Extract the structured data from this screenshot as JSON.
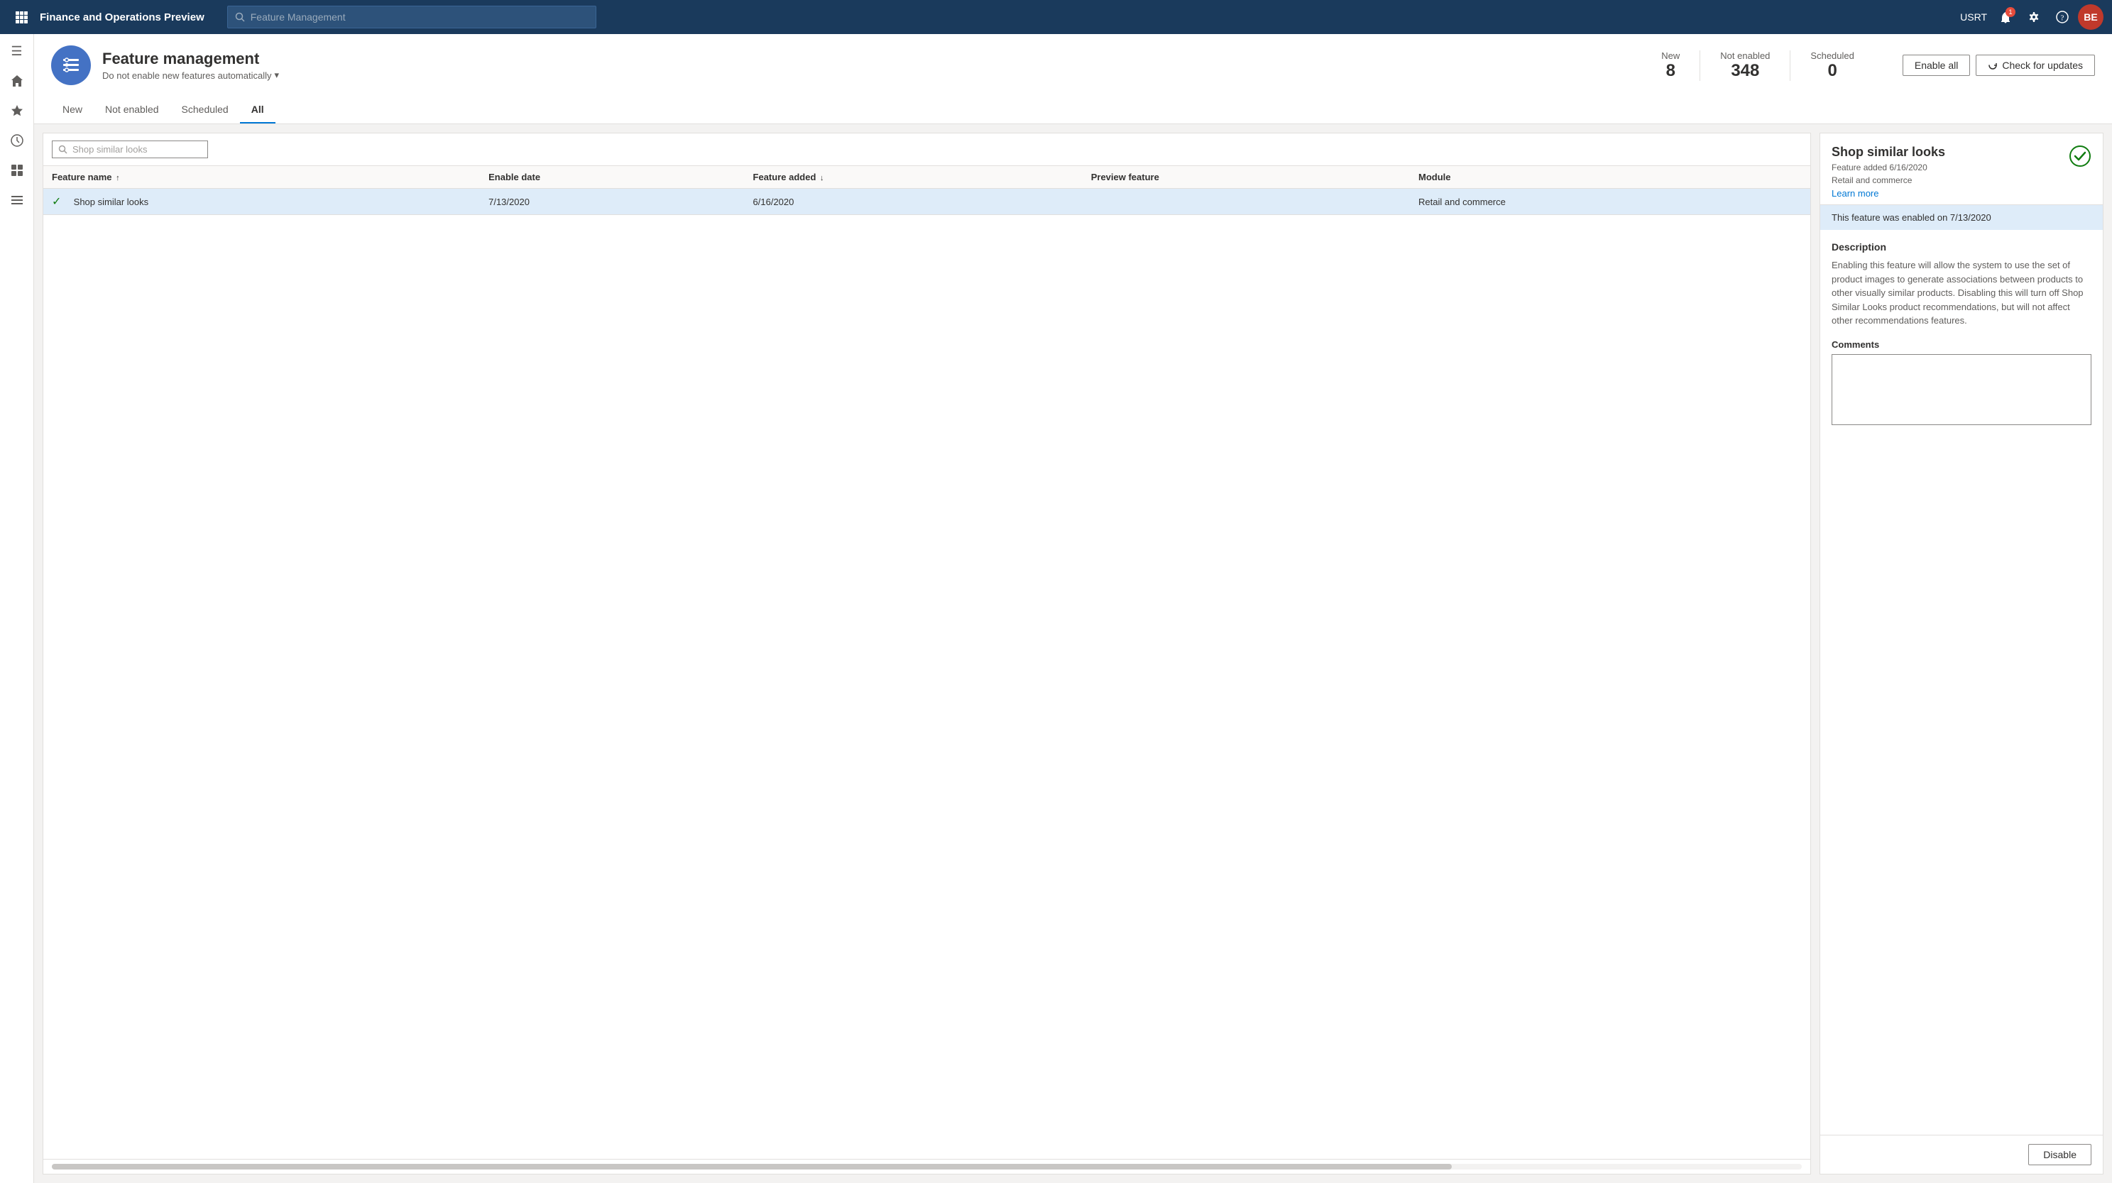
{
  "app": {
    "title": "Finance and Operations Preview"
  },
  "search_placeholder": "Feature Management",
  "topnav": {
    "username": "USRT",
    "avatar_initials": "BE",
    "notification_count": "1"
  },
  "page_header": {
    "title": "Feature management",
    "subtitle": "Do not enable new features automatically",
    "icon_symbol": "≡"
  },
  "stats": [
    {
      "label": "New",
      "value": "8"
    },
    {
      "label": "Not enabled",
      "value": "348"
    },
    {
      "label": "Scheduled",
      "value": "0"
    }
  ],
  "buttons": {
    "enable_all": "Enable all",
    "check_updates": "Check for updates"
  },
  "tabs": [
    {
      "label": "New",
      "active": false
    },
    {
      "label": "Not enabled",
      "active": false
    },
    {
      "label": "Scheduled",
      "active": false
    },
    {
      "label": "All",
      "active": true
    }
  ],
  "table": {
    "search_placeholder": "Shop similar looks",
    "columns": [
      {
        "label": "Feature name",
        "sort": "asc"
      },
      {
        "label": "Enable date",
        "sort": null
      },
      {
        "label": "Feature added",
        "sort": "desc"
      },
      {
        "label": "Preview feature",
        "sort": null
      },
      {
        "label": "Module",
        "sort": null
      }
    ],
    "rows": [
      {
        "name": "Shop similar looks",
        "enabled": true,
        "enable_date": "7/13/2020",
        "feature_added": "6/16/2020",
        "preview_feature": "",
        "module": "Retail and commerce",
        "selected": true
      }
    ]
  },
  "detail": {
    "title": "Shop similar looks",
    "feature_added": "Feature added 6/16/2020",
    "module": "Retail and commerce",
    "learn_more": "Learn more",
    "enabled_banner": "This feature was enabled on 7/13/2020",
    "description_title": "Description",
    "description": "Enabling this feature will allow the system to use the set of product images to generate associations between products to other visually similar products. Disabling this will turn off Shop Similar Looks product recommendations, but will not affect other recommendations features.",
    "comments_label": "Comments",
    "comments_placeholder": "",
    "disable_button": "Disable"
  },
  "sidebar": {
    "items": [
      {
        "icon": "☰",
        "name": "hamburger"
      },
      {
        "icon": "⌂",
        "name": "home"
      },
      {
        "icon": "★",
        "name": "favorites"
      },
      {
        "icon": "⟳",
        "name": "recent"
      },
      {
        "icon": "⊞",
        "name": "workspaces"
      },
      {
        "icon": "≔",
        "name": "modules"
      }
    ]
  }
}
